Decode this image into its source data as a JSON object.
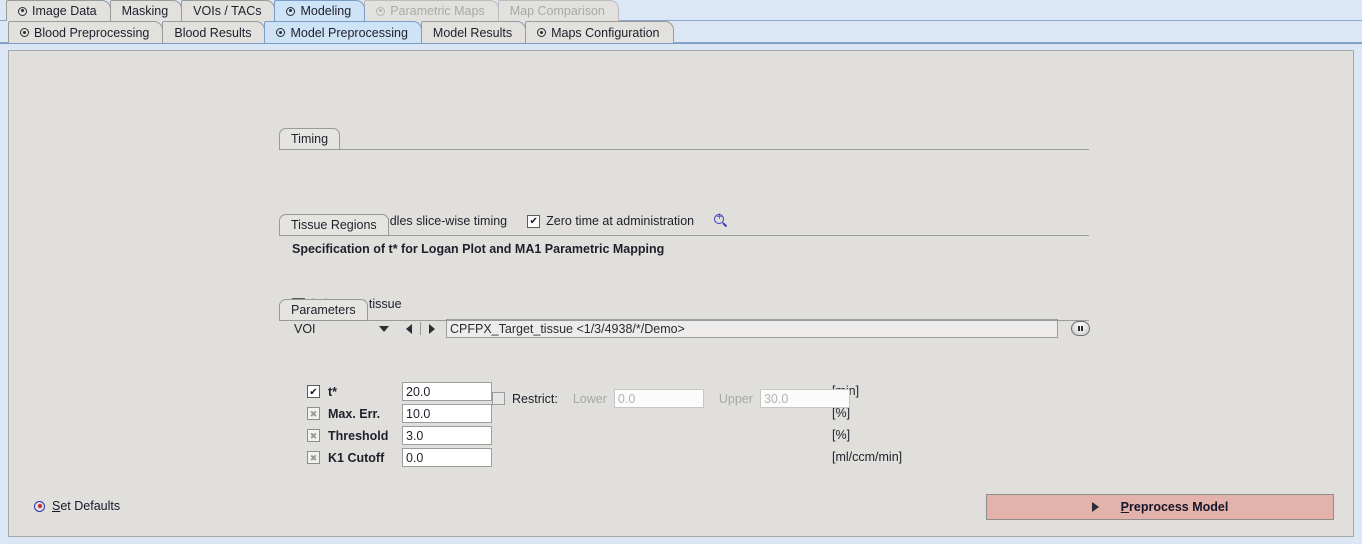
{
  "top_tabs": [
    {
      "label": "Image Data",
      "state": "enabled",
      "radio": true
    },
    {
      "label": "Masking",
      "state": "enabled",
      "radio": false
    },
    {
      "label": "VOIs / TACs",
      "state": "enabled",
      "radio": false
    },
    {
      "label": "Modeling",
      "state": "active",
      "radio": true
    },
    {
      "label": "Parametric Maps",
      "state": "disabled",
      "radio": true
    },
    {
      "label": "Map Comparison",
      "state": "disabled",
      "radio": false
    }
  ],
  "sub_tabs": [
    {
      "label": "Blood Preprocessing",
      "state": "enabled",
      "radio": true
    },
    {
      "label": "Blood Results",
      "state": "enabled",
      "radio": false
    },
    {
      "label": "Model Preprocessing",
      "state": "active",
      "radio": true
    },
    {
      "label": "Model Results",
      "state": "enabled",
      "radio": false
    },
    {
      "label": "Maps Configuration",
      "state": "enabled",
      "radio": true
    }
  ],
  "timing": {
    "group_title": "Timing",
    "slice_wise": {
      "prefix": "[M]",
      "label": "Model handles slice-wise timing",
      "checkbox_state": "x-checked"
    },
    "zero_time": {
      "label": "Zero time at administration",
      "checkbox_state": "checked"
    },
    "magnifier_icon": "magnifier-plus-icon",
    "specification_text": "Specification of t* for Logan Plot and MA1 Parametric Mapping"
  },
  "tissue_regions": {
    "group_title": "Tissue Regions",
    "target_tissue": {
      "prefix": "[O]",
      "label": "Target tissue",
      "checkbox_state": "x-checked"
    },
    "voi": {
      "label": "VOI",
      "value": "CPFPX_Target_tissue <1/3/4938/*/Demo>",
      "dropdown_icon": "chevron-down-icon",
      "prev_icon": "triangle-left-icon",
      "next_icon": "triangle-right-icon",
      "browse_label": "..."
    }
  },
  "parameters": {
    "group_title": "Parameters",
    "rows": [
      {
        "label": "t*",
        "value": "20.0",
        "unit": "[min]",
        "checkbox_state": "checked",
        "bold": false
      },
      {
        "label": "Max. Err.",
        "value": "10.0",
        "unit": "[%]",
        "checkbox_state": "x-dim",
        "bold": true
      },
      {
        "label": "Threshold",
        "value": "3.0",
        "unit": "[%]",
        "checkbox_state": "x-dim",
        "bold": true
      },
      {
        "label": "K1 Cutoff",
        "value": "0.0",
        "unit": "[ml/ccm/min]",
        "checkbox_state": "x-dim",
        "bold": true
      }
    ],
    "restrict": {
      "label": "Restrict:",
      "checkbox_state": "unchecked",
      "lower_label": "Lower",
      "lower_value": "0.0",
      "upper_label": "Upper",
      "upper_value": "30.0"
    }
  },
  "footer": {
    "set_defaults": {
      "mnemonic": "S",
      "rest": "et Defaults",
      "icon": "target-icon"
    },
    "preprocess": {
      "mnemonic": "P",
      "rest": "reprocess Model",
      "icon": "play-triangle-icon"
    }
  },
  "colors": {
    "tab_active": "#cfe3f7",
    "frame_blue": "#dbe7f5",
    "panel_gray": "#e1dfdc",
    "action_button": "#e3b2ab"
  }
}
